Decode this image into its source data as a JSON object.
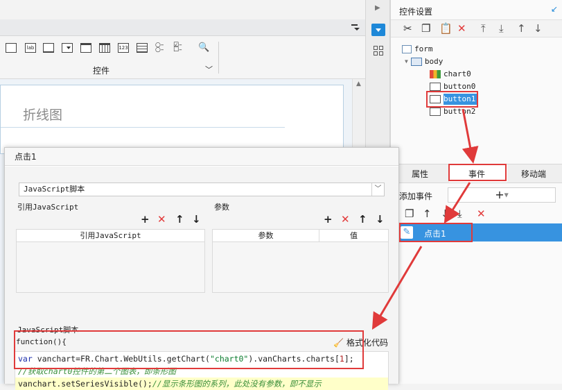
{
  "editor": {
    "chart_title": "折线图",
    "widget_group_label": "控件",
    "widget_icons": [
      "button-widget-icon",
      "label-widget-icon",
      "textfield-widget-icon",
      "combobox-widget-icon",
      "listbox-widget-icon",
      "date-widget-icon",
      "number-widget-icon",
      "textarea-widget-icon",
      "radio-group-widget-icon",
      "checkbox-group-widget-icon",
      "query-widget-icon"
    ],
    "widget_icon_texts": [
      "",
      "lab",
      "",
      "",
      "",
      "",
      "123",
      "",
      "",
      "",
      ""
    ]
  },
  "right_panel": {
    "title": "控件设置",
    "tree": [
      {
        "label": "form",
        "depth": 0
      },
      {
        "label": "body",
        "depth": 1
      },
      {
        "label": "chart0",
        "depth": 2
      },
      {
        "label": "button0",
        "depth": 2
      },
      {
        "label": "button1",
        "depth": 2,
        "selected": true
      },
      {
        "label": "button2",
        "depth": 2
      }
    ],
    "tabs": [
      "属性",
      "事件",
      "移动端"
    ],
    "active_tab": "事件",
    "add_event_label": "添加事件",
    "add_event_button": "+",
    "event_item": "点击1"
  },
  "dialog": {
    "title": "点击1",
    "type_select": "JavaScript脚本",
    "ref_js_label": "引用JavaScript",
    "params_label": "参数",
    "ref_js_column": "引用JavaScript",
    "param_columns": [
      "参数",
      "值"
    ],
    "script_label": "JavaScript脚本",
    "function_header": "function(){",
    "format_button": "格式化代码",
    "code": {
      "line1_kw": "var",
      "line1_a": " vanchart=FR.Chart.WebUtils.getChart(",
      "line1_str": "\"chart0\"",
      "line1_b": ").vanCharts.charts[",
      "line1_num": "1",
      "line1_c": "];",
      "line2": "//获取chart0控件的第二个图表，即条形图",
      "line3_a": "vanchart.setSeriesVisible();",
      "line3_cmt": "//显示条形图的系列，此处没有参数，即不显示"
    }
  },
  "colors": {
    "accent": "#3793e0",
    "highlight_red": "#e03a3a",
    "code_comment": "#3b8f3b"
  }
}
